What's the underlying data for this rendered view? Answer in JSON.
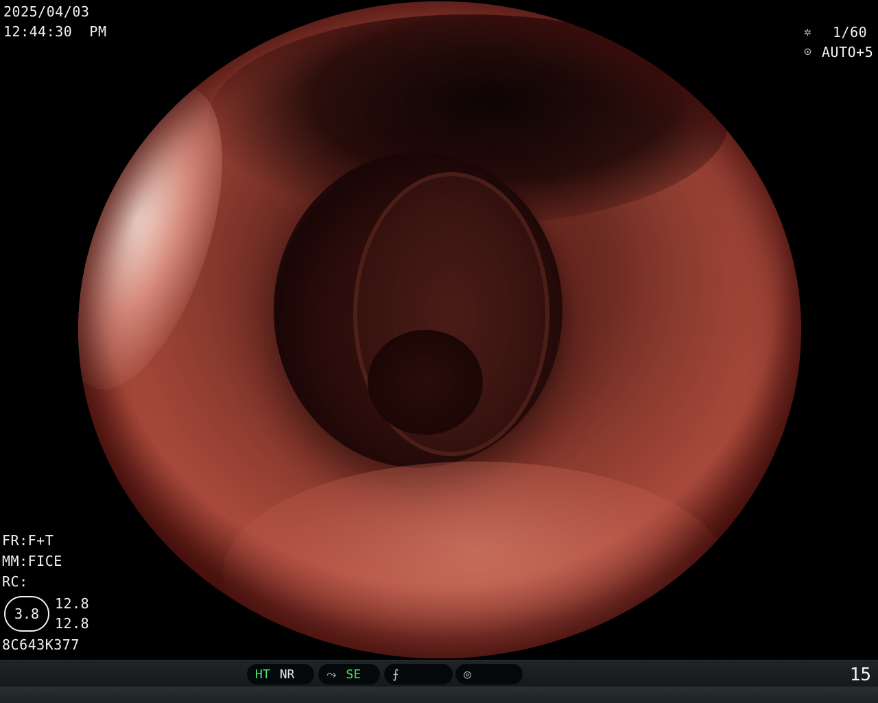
{
  "header": {
    "date": "2025/04/03",
    "time": "12:44:30  PM"
  },
  "top_right": {
    "shutter_icon": "shutter-icon",
    "shutter": "1/60",
    "iris_icon": "iris-icon",
    "iris": "AUTO+5"
  },
  "left_panel": {
    "fr": "FR:F+T",
    "mm": "MM:FICE",
    "rc": "RC:",
    "ring_value": "3.8",
    "value_top": "12.8",
    "value_bottom": "12.8",
    "scope_id": "8C643K377"
  },
  "statusbar": {
    "ht": "HT",
    "nr": "NR",
    "se": "SE",
    "page": "15"
  },
  "colors": {
    "active_indicator": "#49e46a",
    "overlay_text": "#f2f2f2"
  }
}
